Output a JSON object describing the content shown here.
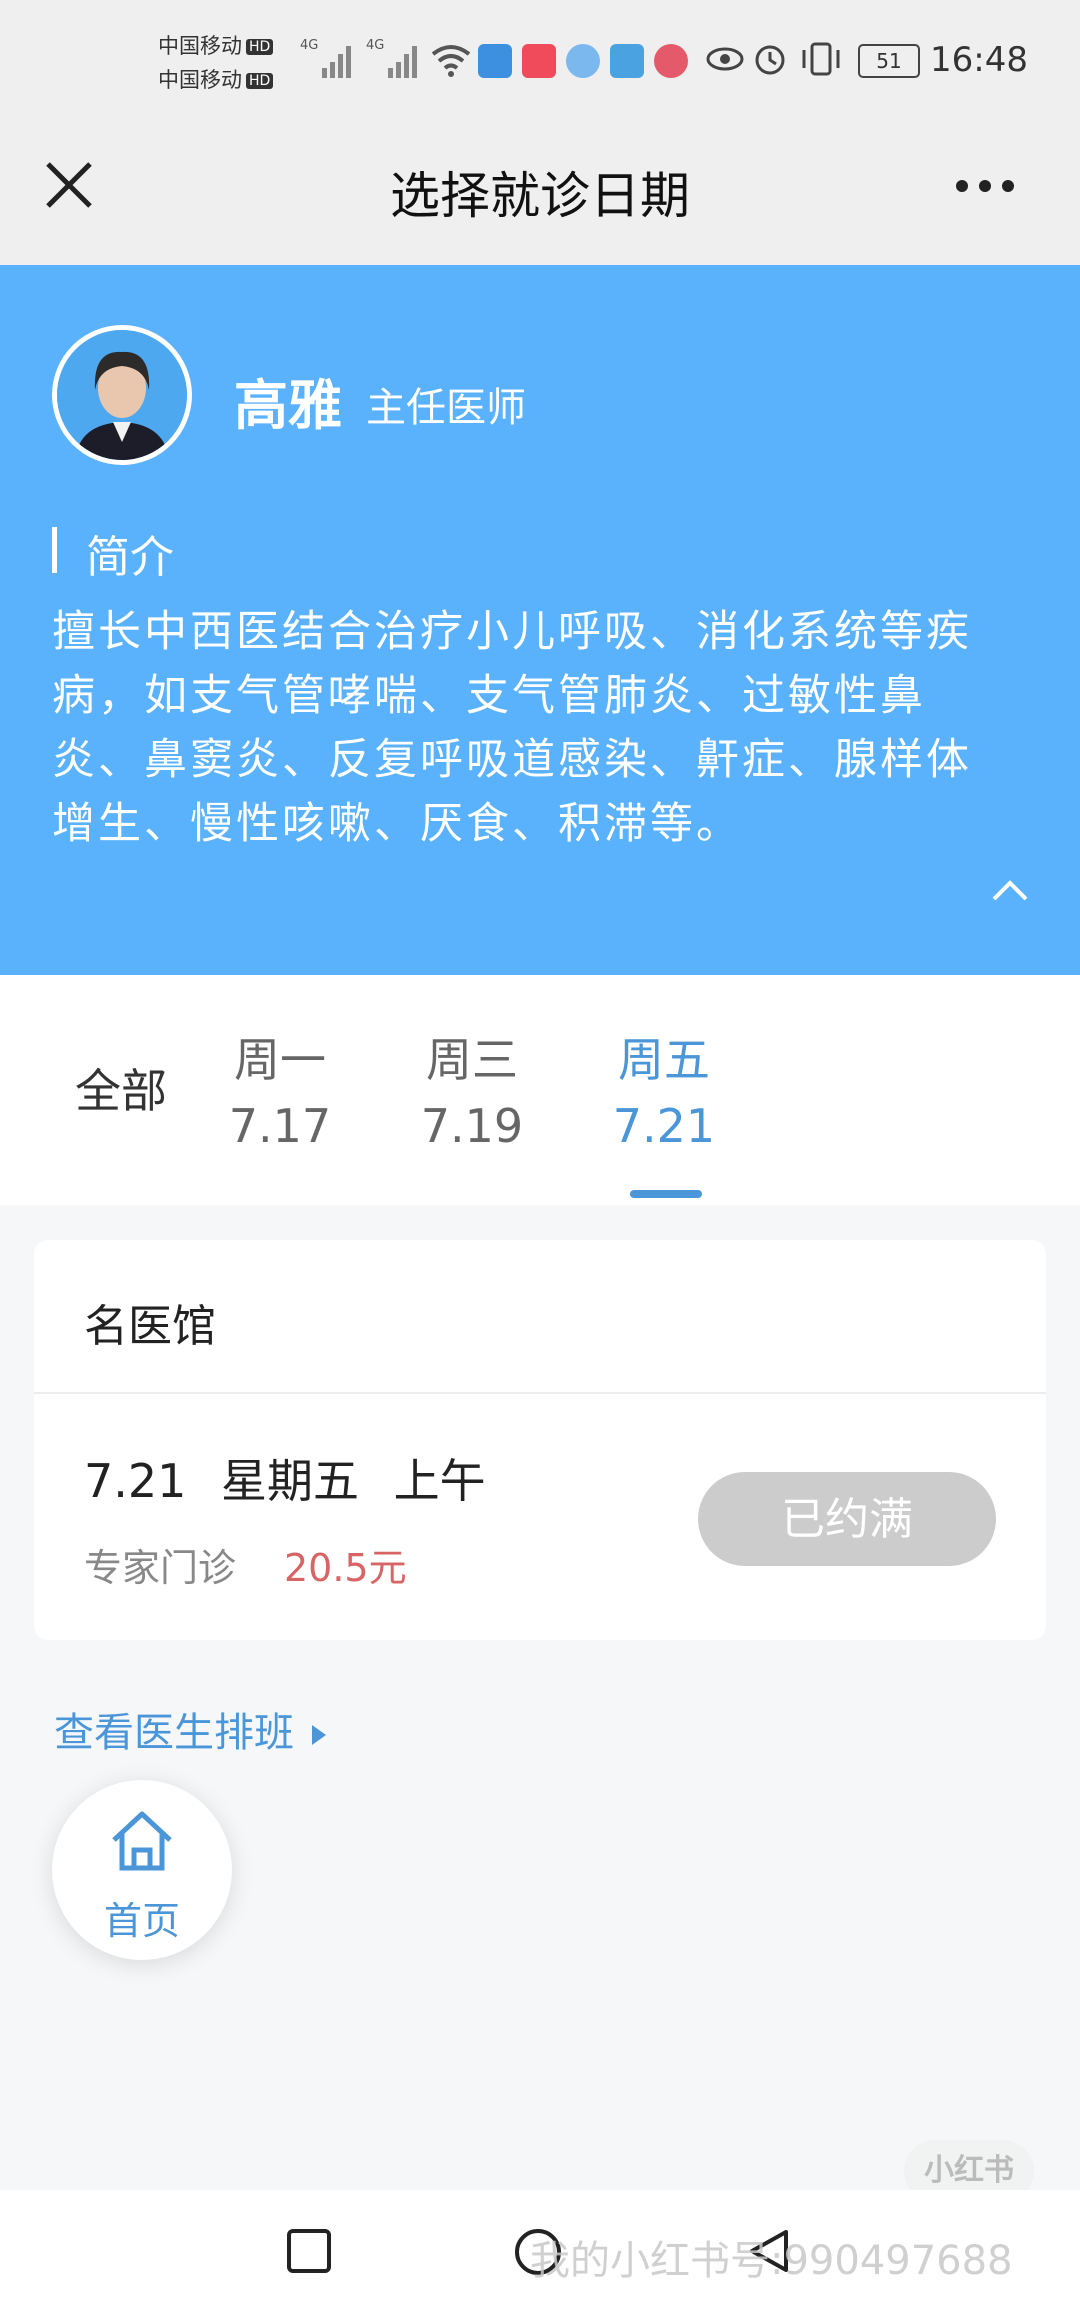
{
  "status_bar": {
    "carrier1": "中国移动",
    "carrier2": "中国移动",
    "hd": "HD",
    "net1": "4G",
    "net2": "4G",
    "battery": "51",
    "time": "16:48"
  },
  "header": {
    "title": "选择就诊日期",
    "close_icon": "close-icon",
    "more_icon": "more-icon"
  },
  "doctor": {
    "name": "高雅",
    "title": "主任医师",
    "intro_label": "简介",
    "intro_text": "擅长中西医结合治疗小儿呼吸、消化系统等疾病，如支气管哮喘、支气管肺炎、过敏性鼻炎、鼻窦炎、反复呼吸道感染、鼾症、腺样体增生、慢性咳嗽、厌食、积滞等。"
  },
  "tabs": {
    "all": "全部",
    "items": [
      {
        "day": "周一",
        "date": "7.17"
      },
      {
        "day": "周三",
        "date": "7.19"
      },
      {
        "day": "周五",
        "date": "7.21",
        "active": true
      }
    ]
  },
  "card": {
    "hospital": "名医馆",
    "slot": "7.21 星期五 上午",
    "type": "专家门诊",
    "price": "20.5元",
    "button": "已约满"
  },
  "schedule_link": "查看医生排班",
  "home_fab": {
    "label": "首页",
    "icon": "home-icon"
  },
  "watermark": {
    "text": "我的小红书号:990497688",
    "logo": "小红书"
  },
  "colors": {
    "primary": "#5ab1fc",
    "accent": "#4a96d8",
    "price": "#d86466",
    "disabled": "#cccccc"
  }
}
